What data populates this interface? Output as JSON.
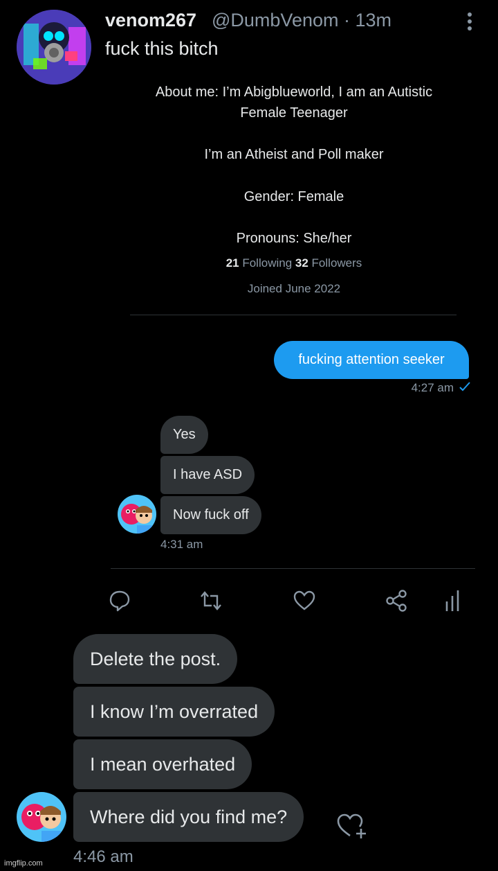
{
  "tweet": {
    "display_name": "venom267",
    "handle_time": "@DumbVenom · 13m",
    "text": "fuck this bitch"
  },
  "profile": {
    "bio_line1": "About me: I’m Abigblueworld, I am an Autistic",
    "bio_line2": "Female Teenager",
    "bio_line3": "I’m an Atheist and Poll maker",
    "bio_line4": "Gender: Female",
    "bio_line5": "Pronouns: She/her",
    "following_count": "21",
    "following_label": "Following",
    "followers_count": "32",
    "followers_label": "Followers",
    "joined": "Joined June 2022"
  },
  "dm1": {
    "sent": "fucking attention seeker",
    "sent_time": "4:27 am",
    "received": [
      "Yes",
      "I have ASD",
      "Now fuck off"
    ],
    "received_time": "4:31 am"
  },
  "dm2": {
    "received": [
      "Delete the post.",
      "I know I’m overrated",
      "I mean overhated",
      "Where did you find me?"
    ],
    "time": "4:46 am"
  },
  "actions": [
    "reply-icon",
    "retweet-icon",
    "like-icon",
    "share-icon",
    "analytics-icon"
  ],
  "watermark": "imgflip.com",
  "colors": {
    "accent": "#1d9bf0",
    "bubble": "#2f3336",
    "muted": "#8b98a5"
  }
}
